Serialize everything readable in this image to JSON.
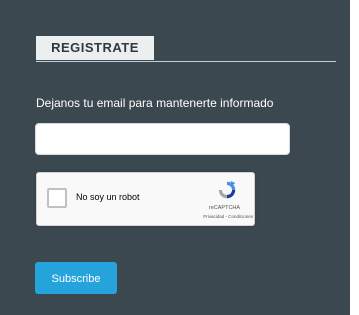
{
  "form": {
    "heading": "REGISTRATE",
    "subtitle": "Dejanos tu email para mantenerte informado",
    "email": {
      "value": "",
      "placeholder": ""
    },
    "recaptcha": {
      "label": "No soy un robot",
      "brand": "reCAPTCHA",
      "terms": "Privacidad - Condiciones",
      "checked": false
    },
    "submit_label": "Subscribe"
  },
  "colors": {
    "panel_background": "#3c4850",
    "header_tab_background": "#eceff0",
    "button_accent": "#25a4dc"
  },
  "icons": {
    "recaptcha_logo": "recaptcha-icon"
  }
}
